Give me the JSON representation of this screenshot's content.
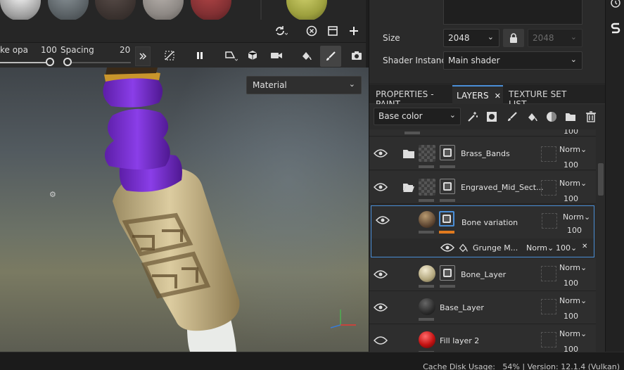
{
  "shelf": {
    "balls": [
      "white-material",
      "fabric-gray",
      "fabric-brown",
      "fabric-light",
      "fabric-red",
      "olive-sphere"
    ]
  },
  "toolbar": {
    "stroke_opacity_label": "ke opa",
    "stroke_opacity_value": "100",
    "spacing_label": "Spacing",
    "spacing_value": "20"
  },
  "viewport": {
    "display_mode": "Material"
  },
  "properties": {
    "size_label": "Size",
    "size_value": "2048",
    "size_linked_value": "2048",
    "shader_label": "Shader Instance",
    "shader_value": "Main shader"
  },
  "tabs": {
    "properties": "PROPERTIES - PAINT",
    "layers": "LAYERS",
    "close": "✕",
    "texture_set": "TEXTURE SET LIST"
  },
  "layer_tools": {
    "channel": "Base color"
  },
  "layers": {
    "top_value": "100",
    "items": [
      {
        "name": "Brass_Bands",
        "blend": "Norm",
        "opacity": "100"
      },
      {
        "name": "Engraved_Mid_Sect...",
        "blend": "Norm",
        "opacity": "100"
      },
      {
        "name": "Bone variation",
        "blend": "Norm",
        "opacity": "100"
      },
      {
        "name": "Bone_Layer",
        "blend": "Norm",
        "opacity": "100"
      },
      {
        "name": "Base_Layer",
        "blend": "Norm",
        "opacity": "100"
      },
      {
        "name": "Fill layer 2",
        "blend": "Norm",
        "opacity": "100"
      }
    ],
    "effect": {
      "name": "Grunge M...",
      "blend": "Norm",
      "opacity": "100",
      "close": "✕"
    }
  },
  "status": {
    "text": "Cache Disk Usage:   54% | Version: 12.1.4 (Vulkan)"
  }
}
